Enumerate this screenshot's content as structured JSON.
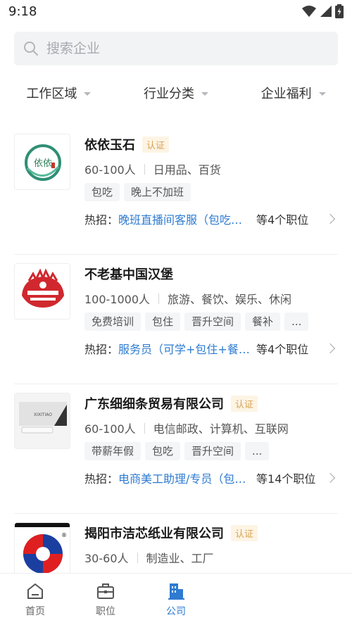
{
  "status_bar": {
    "time": "9:18"
  },
  "search": {
    "placeholder": "搜索企业"
  },
  "filters": [
    {
      "label": "工作区域"
    },
    {
      "label": "行业分类"
    },
    {
      "label": "企业福利"
    }
  ],
  "companies": [
    {
      "name": "依依玉石",
      "verified": true,
      "badge": "认证",
      "size": "60-100人",
      "industry": "日用品、百货",
      "tags": [
        "包吃",
        "晚上不加班"
      ],
      "hot_prefix": "热招：",
      "hot_job": "晚班直播间客服（包吃＋…",
      "hot_count": "等4个职位",
      "logo_text": "依依"
    },
    {
      "name": "不老基中国汉堡",
      "verified": false,
      "size": "100-1000人",
      "industry": "旅游、餐饮、娱乐、休闲",
      "tags": [
        "免费培训",
        "包住",
        "晋升空间",
        "餐补",
        "..."
      ],
      "hot_prefix": "热招：",
      "hot_job": "服务员（可学+包住+餐…",
      "hot_count": "等4个职位"
    },
    {
      "name": "广东细细条贸易有限公司",
      "verified": true,
      "badge": "认证",
      "size": "60-100人",
      "industry": "电信邮政、计算机、互联网",
      "tags": [
        "带薪年假",
        "包吃",
        "晋升空间",
        "..."
      ],
      "hot_prefix": "热招：",
      "hot_job": "电商美工助理/专员（包…",
      "hot_count": "等14个职位",
      "logo_text": "XIXITIAO"
    },
    {
      "name": "揭阳市洁芯纸业有限公司",
      "verified": true,
      "badge": "认证",
      "size": "30-60人",
      "industry": "制造业、工厂",
      "tags": [],
      "hot_prefix": "",
      "hot_job": "",
      "hot_count": ""
    }
  ],
  "tabbar": {
    "items": [
      {
        "label": "首页",
        "icon": "home-icon",
        "active": false
      },
      {
        "label": "职位",
        "icon": "briefcase-icon",
        "active": false
      },
      {
        "label": "公司",
        "icon": "building-icon",
        "active": true
      }
    ]
  },
  "colors": {
    "accent": "#2e7bd1",
    "badge_text": "#d6a354",
    "badge_bg": "#fdf4e4",
    "tag_bg": "#f4f5f7",
    "search_bg": "#f2f3f5"
  }
}
